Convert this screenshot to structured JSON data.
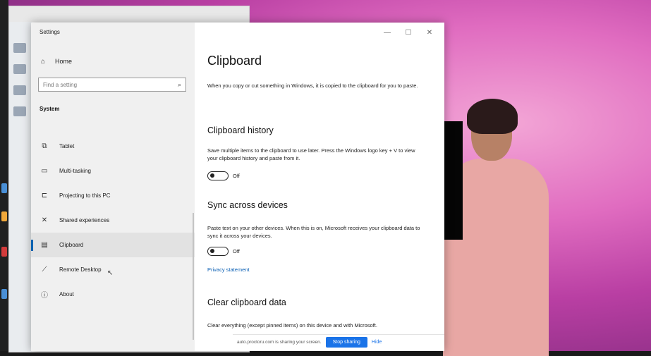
{
  "window": {
    "title": "Settings",
    "controls": [
      "—",
      "☐",
      "✕"
    ]
  },
  "nav": {
    "home_label": "Home",
    "search_placeholder": "Find a setting",
    "section": "System",
    "items": [
      {
        "icon": "tablet-icon",
        "glyph": "⧉",
        "label": "Tablet"
      },
      {
        "icon": "multitasking-icon",
        "glyph": "▭",
        "label": "Multi-tasking"
      },
      {
        "icon": "projecting-icon",
        "glyph": "⊏",
        "label": "Projecting to this PC"
      },
      {
        "icon": "shared-experiences-icon",
        "glyph": "✕",
        "label": "Shared experiences"
      },
      {
        "icon": "clipboard-icon",
        "glyph": "▤",
        "label": "Clipboard",
        "active": true
      },
      {
        "icon": "remote-desktop-icon",
        "glyph": "⟋",
        "label": "Remote Desktop"
      },
      {
        "icon": "about-icon",
        "glyph": "ⓘ",
        "label": "About"
      }
    ]
  },
  "content": {
    "title": "Clipboard",
    "intro": "When you copy or cut something in Windows, it is copied to the clipboard for you to paste.",
    "history": {
      "heading": "Clipboard history",
      "description": "Save multiple items to the clipboard to use later. Press the Windows logo key + V to view your clipboard history and paste from it.",
      "toggle_state": "Off"
    },
    "sync": {
      "heading": "Sync across devices",
      "description": "Paste text on your other devices. When this is on, Microsoft receives your clipboard data to sync it across your devices.",
      "toggle_state": "Off",
      "privacy_link": "Privacy statement"
    },
    "clear": {
      "heading": "Clear clipboard data",
      "description": "Clear everything (except pinned items) on this device and with Microsoft."
    }
  },
  "share_bar": {
    "message": "auto.proctoru.com is sharing your screen.",
    "stop_label": "Stop sharing",
    "hide_label": "Hide"
  }
}
